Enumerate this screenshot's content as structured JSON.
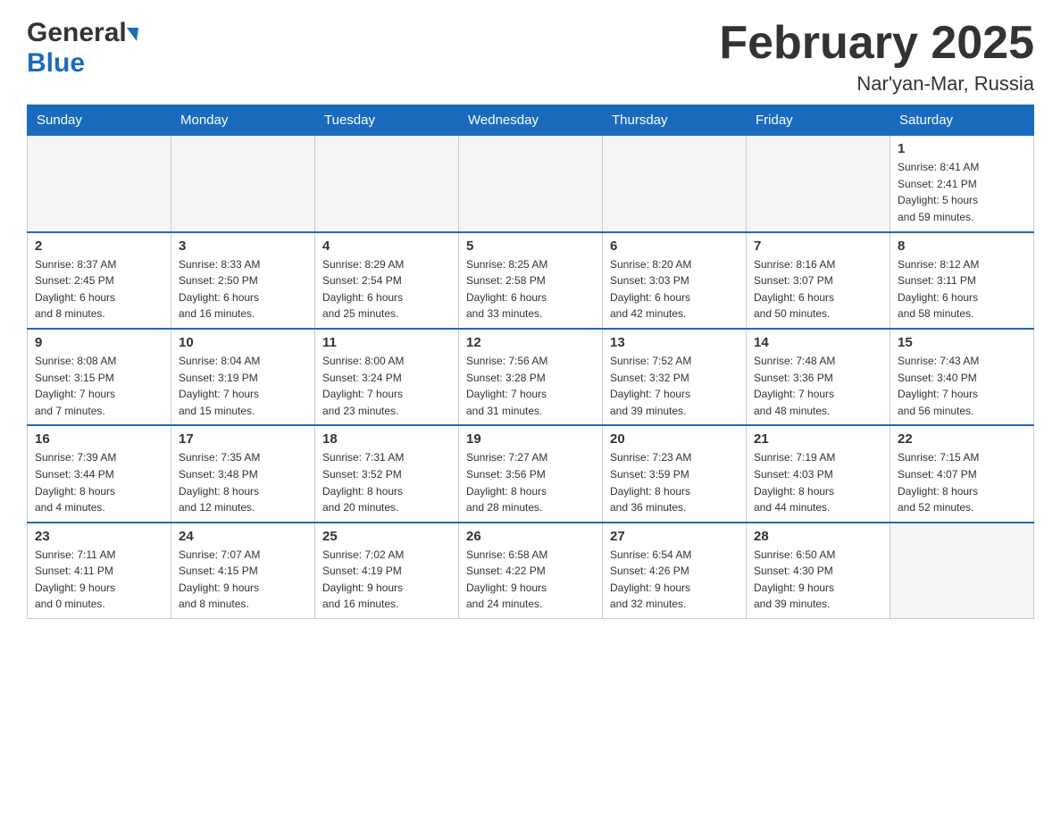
{
  "header": {
    "logo_general": "General",
    "logo_blue": "Blue",
    "month_title": "February 2025",
    "location": "Nar'yan-Mar, Russia"
  },
  "days_of_week": [
    "Sunday",
    "Monday",
    "Tuesday",
    "Wednesday",
    "Thursday",
    "Friday",
    "Saturday"
  ],
  "weeks": [
    [
      {
        "day": "",
        "info": ""
      },
      {
        "day": "",
        "info": ""
      },
      {
        "day": "",
        "info": ""
      },
      {
        "day": "",
        "info": ""
      },
      {
        "day": "",
        "info": ""
      },
      {
        "day": "",
        "info": ""
      },
      {
        "day": "1",
        "info": "Sunrise: 8:41 AM\nSunset: 2:41 PM\nDaylight: 5 hours\nand 59 minutes."
      }
    ],
    [
      {
        "day": "2",
        "info": "Sunrise: 8:37 AM\nSunset: 2:45 PM\nDaylight: 6 hours\nand 8 minutes."
      },
      {
        "day": "3",
        "info": "Sunrise: 8:33 AM\nSunset: 2:50 PM\nDaylight: 6 hours\nand 16 minutes."
      },
      {
        "day": "4",
        "info": "Sunrise: 8:29 AM\nSunset: 2:54 PM\nDaylight: 6 hours\nand 25 minutes."
      },
      {
        "day": "5",
        "info": "Sunrise: 8:25 AM\nSunset: 2:58 PM\nDaylight: 6 hours\nand 33 minutes."
      },
      {
        "day": "6",
        "info": "Sunrise: 8:20 AM\nSunset: 3:03 PM\nDaylight: 6 hours\nand 42 minutes."
      },
      {
        "day": "7",
        "info": "Sunrise: 8:16 AM\nSunset: 3:07 PM\nDaylight: 6 hours\nand 50 minutes."
      },
      {
        "day": "8",
        "info": "Sunrise: 8:12 AM\nSunset: 3:11 PM\nDaylight: 6 hours\nand 58 minutes."
      }
    ],
    [
      {
        "day": "9",
        "info": "Sunrise: 8:08 AM\nSunset: 3:15 PM\nDaylight: 7 hours\nand 7 minutes."
      },
      {
        "day": "10",
        "info": "Sunrise: 8:04 AM\nSunset: 3:19 PM\nDaylight: 7 hours\nand 15 minutes."
      },
      {
        "day": "11",
        "info": "Sunrise: 8:00 AM\nSunset: 3:24 PM\nDaylight: 7 hours\nand 23 minutes."
      },
      {
        "day": "12",
        "info": "Sunrise: 7:56 AM\nSunset: 3:28 PM\nDaylight: 7 hours\nand 31 minutes."
      },
      {
        "day": "13",
        "info": "Sunrise: 7:52 AM\nSunset: 3:32 PM\nDaylight: 7 hours\nand 39 minutes."
      },
      {
        "day": "14",
        "info": "Sunrise: 7:48 AM\nSunset: 3:36 PM\nDaylight: 7 hours\nand 48 minutes."
      },
      {
        "day": "15",
        "info": "Sunrise: 7:43 AM\nSunset: 3:40 PM\nDaylight: 7 hours\nand 56 minutes."
      }
    ],
    [
      {
        "day": "16",
        "info": "Sunrise: 7:39 AM\nSunset: 3:44 PM\nDaylight: 8 hours\nand 4 minutes."
      },
      {
        "day": "17",
        "info": "Sunrise: 7:35 AM\nSunset: 3:48 PM\nDaylight: 8 hours\nand 12 minutes."
      },
      {
        "day": "18",
        "info": "Sunrise: 7:31 AM\nSunset: 3:52 PM\nDaylight: 8 hours\nand 20 minutes."
      },
      {
        "day": "19",
        "info": "Sunrise: 7:27 AM\nSunset: 3:56 PM\nDaylight: 8 hours\nand 28 minutes."
      },
      {
        "day": "20",
        "info": "Sunrise: 7:23 AM\nSunset: 3:59 PM\nDaylight: 8 hours\nand 36 minutes."
      },
      {
        "day": "21",
        "info": "Sunrise: 7:19 AM\nSunset: 4:03 PM\nDaylight: 8 hours\nand 44 minutes."
      },
      {
        "day": "22",
        "info": "Sunrise: 7:15 AM\nSunset: 4:07 PM\nDaylight: 8 hours\nand 52 minutes."
      }
    ],
    [
      {
        "day": "23",
        "info": "Sunrise: 7:11 AM\nSunset: 4:11 PM\nDaylight: 9 hours\nand 0 minutes."
      },
      {
        "day": "24",
        "info": "Sunrise: 7:07 AM\nSunset: 4:15 PM\nDaylight: 9 hours\nand 8 minutes."
      },
      {
        "day": "25",
        "info": "Sunrise: 7:02 AM\nSunset: 4:19 PM\nDaylight: 9 hours\nand 16 minutes."
      },
      {
        "day": "26",
        "info": "Sunrise: 6:58 AM\nSunset: 4:22 PM\nDaylight: 9 hours\nand 24 minutes."
      },
      {
        "day": "27",
        "info": "Sunrise: 6:54 AM\nSunset: 4:26 PM\nDaylight: 9 hours\nand 32 minutes."
      },
      {
        "day": "28",
        "info": "Sunrise: 6:50 AM\nSunset: 4:30 PM\nDaylight: 9 hours\nand 39 minutes."
      },
      {
        "day": "",
        "info": ""
      }
    ]
  ]
}
